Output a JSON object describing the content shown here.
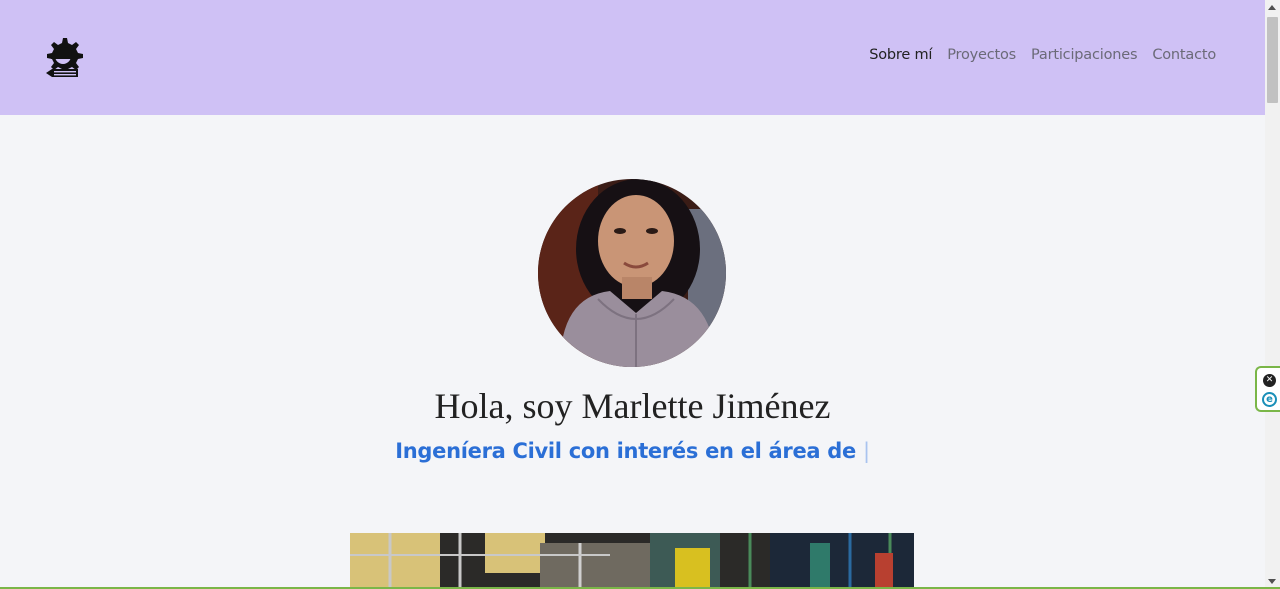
{
  "nav": {
    "links": [
      {
        "label": "Sobre mí",
        "active": true
      },
      {
        "label": "Proyectos",
        "active": false
      },
      {
        "label": "Participaciones",
        "active": false
      },
      {
        "label": "Contacto",
        "active": false
      }
    ],
    "background_color": "#cfc1f5",
    "logo_icon": "engineer-helmet-logo-icon"
  },
  "hero": {
    "greeting": "Hola, soy Marlette Jiménez",
    "subtitle": "Ingeníera Civil con interés en el área de",
    "cursor": "|",
    "subtitle_color": "#2b6fd6",
    "avatar_icon": "profile-photo-avatar"
  },
  "extension": {
    "close_icon": "close-circle-icon",
    "logo_icon": "extension-e-icon",
    "close_glyph": "✕",
    "logo_glyph": "e"
  }
}
